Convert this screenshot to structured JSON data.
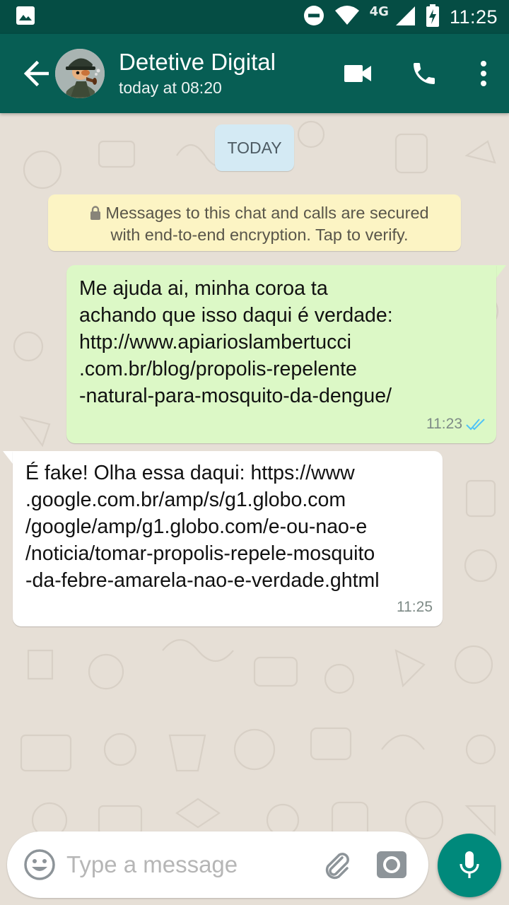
{
  "status_bar": {
    "network": "4G",
    "time": "11:25"
  },
  "header": {
    "contact_name": "Detetive Digital",
    "last_seen": "today at 08:20"
  },
  "chat": {
    "date_separator": "TODAY",
    "encryption_notice": {
      "line1": "Messages to this chat and calls are secured",
      "line2": "with end-to-end encryption. Tap to verify."
    },
    "messages": [
      {
        "direction": "outgoing",
        "lines": [
          "Me ajuda ai, minha coroa ta",
          "achando que isso daqui é verdade:",
          "http://www.apiarioslambertucci",
          ".com.br/blog/propolis-repelente",
          "-natural-para-mosquito-da-dengue/"
        ],
        "time": "11:23",
        "status": "read"
      },
      {
        "direction": "incoming",
        "lines": [
          "É fake! Olha essa daqui:  https://www",
          ".google.com.br/amp/s/g1.globo.com",
          "/google/amp/g1.globo.com/e-ou-nao-e",
          "/noticia/tomar-propolis-repele-mosquito",
          "-da-febre-amarela-nao-e-verdade.ghtml"
        ],
        "time": "11:25"
      }
    ]
  },
  "composer": {
    "placeholder": "Type a message"
  },
  "colors": {
    "status_bar": "#054d44",
    "app_bar": "#075e54",
    "outgoing_bubble": "#dcf8c6",
    "incoming_bubble": "#ffffff",
    "mic_button": "#00897b",
    "read_ticks": "#4fc3f7"
  },
  "icons": {
    "status_left": "image-notification-icon",
    "status_right": [
      "do-not-disturb-icon",
      "wifi-icon",
      "signal-icon",
      "battery-charging-icon"
    ],
    "header": [
      "back-arrow-icon",
      "video-call-icon",
      "phone-icon",
      "more-vert-icon"
    ],
    "composer": [
      "emoji-icon",
      "attach-icon",
      "camera-icon",
      "mic-icon"
    ]
  }
}
